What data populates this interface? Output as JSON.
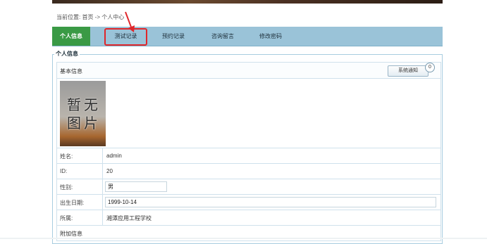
{
  "breadcrumb": "当前位置: 首页 -> 个人中心",
  "nav": {
    "tabs": [
      {
        "label": "个人信息",
        "active": true
      },
      {
        "label": "测试记录",
        "active": false,
        "highlighted": true
      },
      {
        "label": "预约记录",
        "active": false
      },
      {
        "label": "咨询留言",
        "active": false
      },
      {
        "label": "修改密码",
        "active": false
      }
    ]
  },
  "section_legend": "个人信息",
  "basic_info": {
    "title": "基本信息",
    "notify_button": "系统通知",
    "notify_count": "0",
    "photo_placeholder": [
      "暂",
      "无",
      "图",
      "片"
    ]
  },
  "fields": {
    "name": {
      "label": "姓名:",
      "value": "admin"
    },
    "id": {
      "label": "ID:",
      "value": "20"
    },
    "gender": {
      "label": "性别:",
      "value": "男"
    },
    "birthday": {
      "label": "出生日期:",
      "value": "1999-10-14"
    },
    "school": {
      "label": "所属:",
      "value": "湘潭应用工程学校"
    }
  },
  "extra_info_label": "附加信息",
  "colors": {
    "active_tab": "#3a9a45",
    "navbar": "#9ac3d8",
    "highlight": "#e0262a"
  }
}
